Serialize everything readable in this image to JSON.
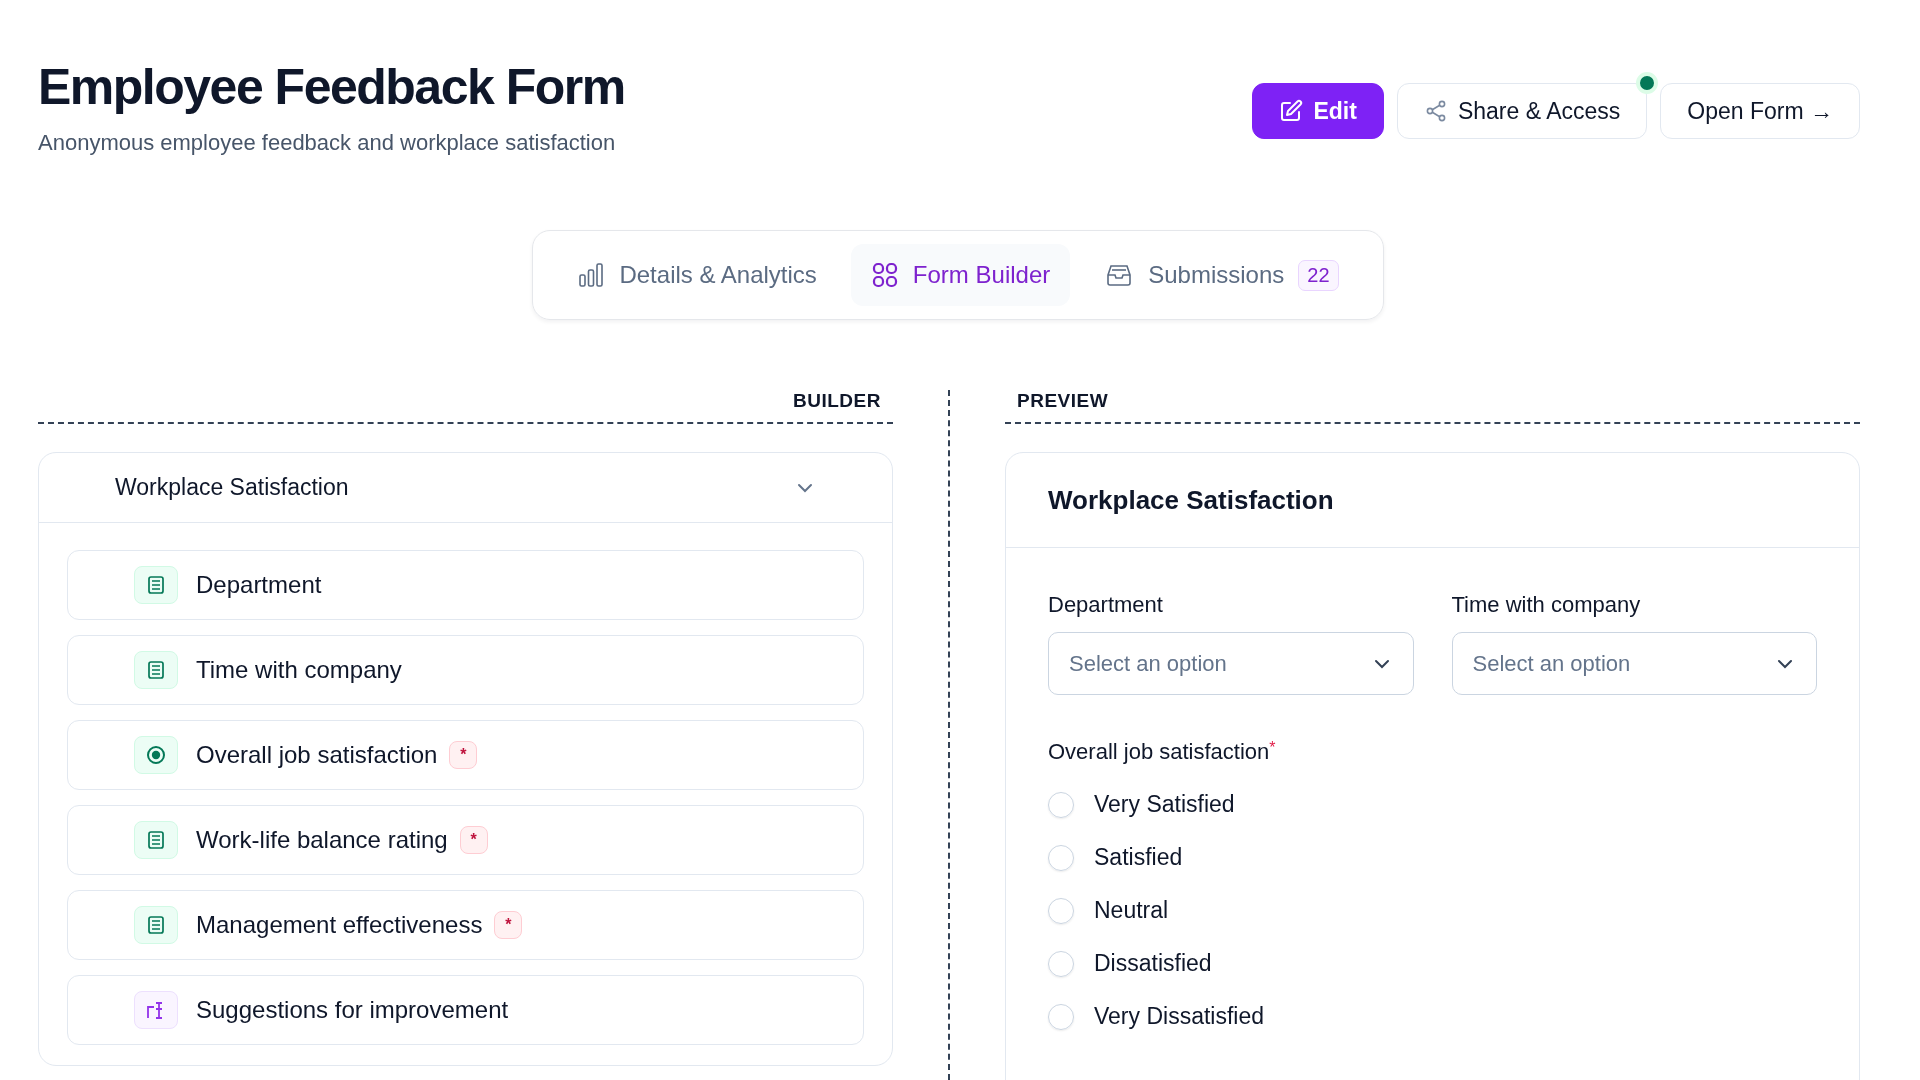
{
  "header": {
    "title": "Employee Feedback Form",
    "subtitle": "Anonymous employee feedback and workplace satisfaction",
    "actions": [
      {
        "kind": "edit",
        "label": "Edit",
        "indicator": false
      },
      {
        "kind": "share",
        "label": "Share & Access",
        "indicator": true
      },
      {
        "kind": "open",
        "label": "Open Form →",
        "indicator": false
      }
    ]
  },
  "tabs": [
    {
      "label": "Details & Analytics",
      "selected": false
    },
    {
      "label": "Form Builder",
      "selected": true
    },
    {
      "label": "Submissions",
      "selected": false,
      "count": "22"
    }
  ],
  "builder": {
    "heading": "BUILDER",
    "section": {
      "title": "Workplace Satisfaction",
      "expanded": true,
      "fields": [
        {
          "label": "Department",
          "kind": "select",
          "required": false
        },
        {
          "label": "Time with company",
          "kind": "select",
          "required": false
        },
        {
          "label": "Overall job satisfaction",
          "kind": "radio",
          "required": true,
          "required_label": "*"
        },
        {
          "label": "Work-life balance rating",
          "kind": "select",
          "required": true,
          "required_label": "*"
        },
        {
          "label": "Management effectiveness",
          "kind": "select",
          "required": true,
          "required_label": "*"
        },
        {
          "label": "Suggestions for improvement",
          "kind": "text",
          "required": false
        }
      ]
    }
  },
  "preview": {
    "heading": "PREVIEW",
    "section": {
      "title": "Workplace Satisfaction",
      "selects": [
        {
          "label": "Department",
          "placeholder": "Select an option"
        },
        {
          "label": "Time with company",
          "placeholder": "Select an option"
        }
      ],
      "question": {
        "label": "Overall job satisfaction",
        "required": true,
        "required_label": "*",
        "options": [
          {
            "label": "Very Satisfied",
            "selected": false
          },
          {
            "label": "Satisfied",
            "selected": false
          },
          {
            "label": "Neutral",
            "selected": false
          },
          {
            "label": "Dissatisfied",
            "selected": false
          },
          {
            "label": "Very Dissatisfied",
            "selected": false
          }
        ]
      }
    }
  }
}
